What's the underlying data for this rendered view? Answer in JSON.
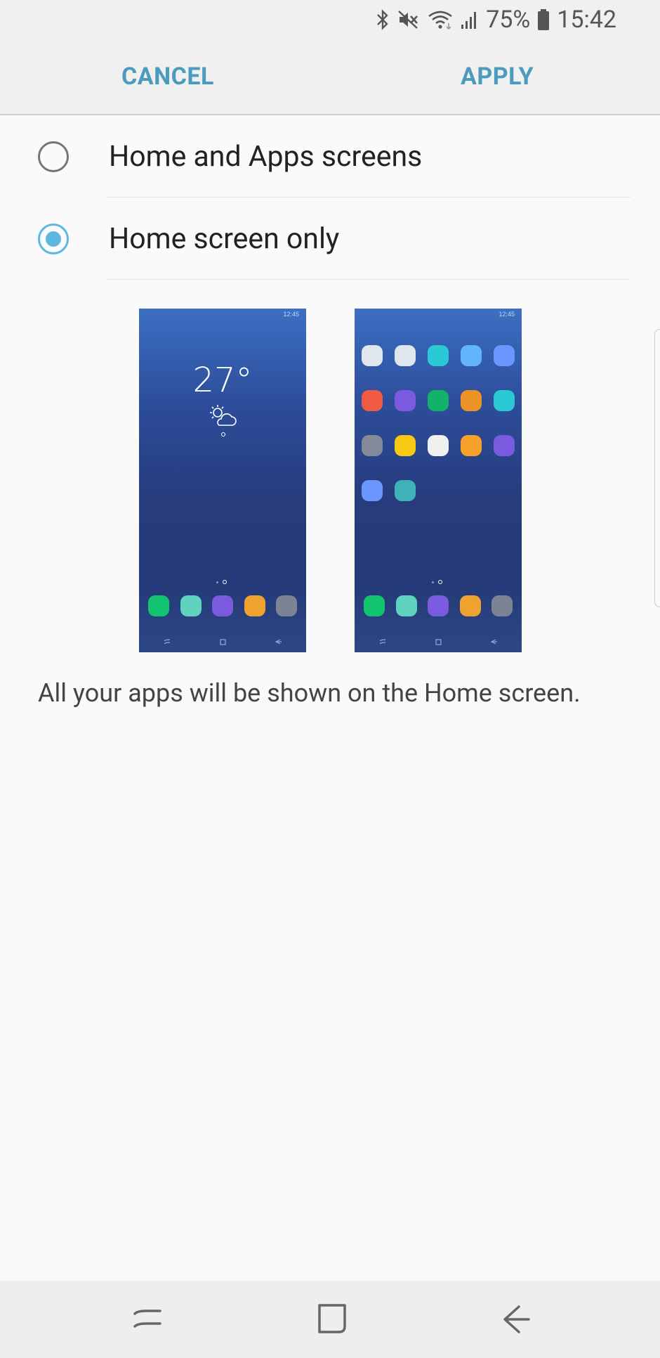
{
  "status_bar": {
    "battery_percent": "75%",
    "time": "15:42",
    "icons": [
      "bluetooth-icon",
      "mute-icon",
      "wifi-icon",
      "signal-icon",
      "battery-icon"
    ]
  },
  "action_bar": {
    "cancel_label": "CANCEL",
    "apply_label": "APPLY",
    "accent_color": "#4a9bbd"
  },
  "options": [
    {
      "label": "Home and Apps screens",
      "selected": false
    },
    {
      "label": "Home screen only",
      "selected": true
    }
  ],
  "previews": {
    "home_preview": {
      "status_time": "12:45",
      "weather_temp": "27°",
      "weather_icon": "partly-cloudy-icon",
      "dock_apps": [
        "#12c46f",
        "#5fd3c0",
        "#7b5ae0",
        "#f0a22e",
        "#7d8294"
      ]
    },
    "apps_preview": {
      "status_time": "12:45",
      "grid_apps": [
        "#dfe6ee",
        "#dfe6ee",
        "#2bc8d6",
        "#62b4fb",
        "#6a97fd",
        "#f05a42",
        "#7b5ae0",
        "#12b26a",
        "#ec9327",
        "#2bc8d6",
        "#858a9a",
        "#f7c913",
        "#f0f0f0",
        "#f5a12a",
        "#7b5ae0",
        "#6a97fd",
        "#3fb1b8"
      ],
      "dock_apps": [
        "#12c46f",
        "#5fd3c0",
        "#7b5ae0",
        "#f0a22e",
        "#7d8294"
      ]
    }
  },
  "description": "All your apps will be shown on the Home screen.",
  "selected_color": "#5cb8e0",
  "nav_bar": {
    "icons": [
      "recents-icon",
      "home-icon",
      "back-icon"
    ]
  }
}
